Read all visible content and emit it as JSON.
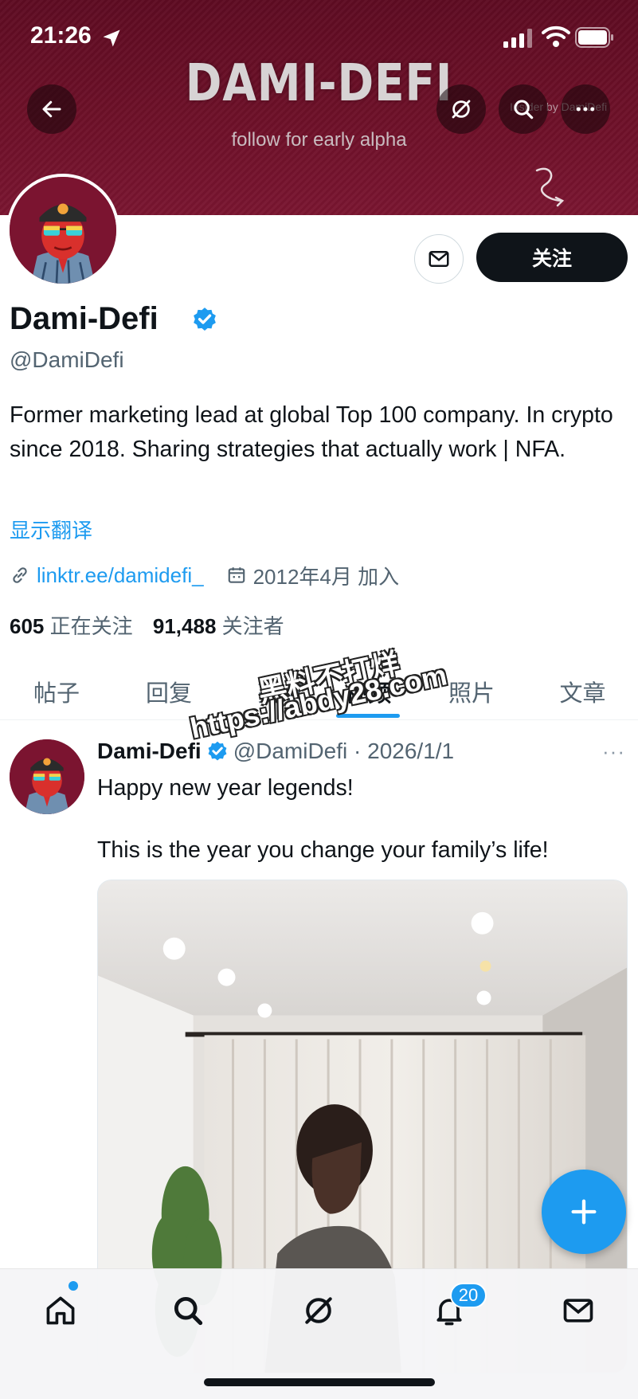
{
  "status_bar": {
    "time": "21:26"
  },
  "banner": {
    "title": "DAMI-DEFI",
    "subtitle": "follow for early alpha",
    "insider_text": "Insider by DamiDefi"
  },
  "profile": {
    "name": "Dami-Defi",
    "handle": "@DamiDefi",
    "bio": "Former marketing lead at global Top 100 company. In crypto since 2018. Sharing strategies that actually work | NFA.",
    "translate_label": "显示翻译",
    "link": "linktr.ee/damidefi_",
    "joined": "2012年4月 加入",
    "following_count": "605",
    "following_label": "正在关注",
    "followers_count": "91,488",
    "followers_label": "关注者",
    "follow_button": "关注"
  },
  "tabs": [
    "帖子",
    "回复",
    "亮点",
    "视频",
    "照片",
    "文章"
  ],
  "watermark": {
    "line1": "黑料不打烊",
    "line2": "https://abdy28.com"
  },
  "tweet": {
    "name": "Dami-Defi",
    "handle_date": "@DamiDefi · 2026/1/1",
    "more": "···",
    "text": "Happy new year legends!\n\nThis is the year you change your family’s life!"
  },
  "bottom_nav": {
    "notifications_badge": "20"
  },
  "colors": {
    "accent": "#1d9bf0",
    "banner": "#6d1028",
    "text": "#0f1419",
    "muted": "#536471"
  }
}
